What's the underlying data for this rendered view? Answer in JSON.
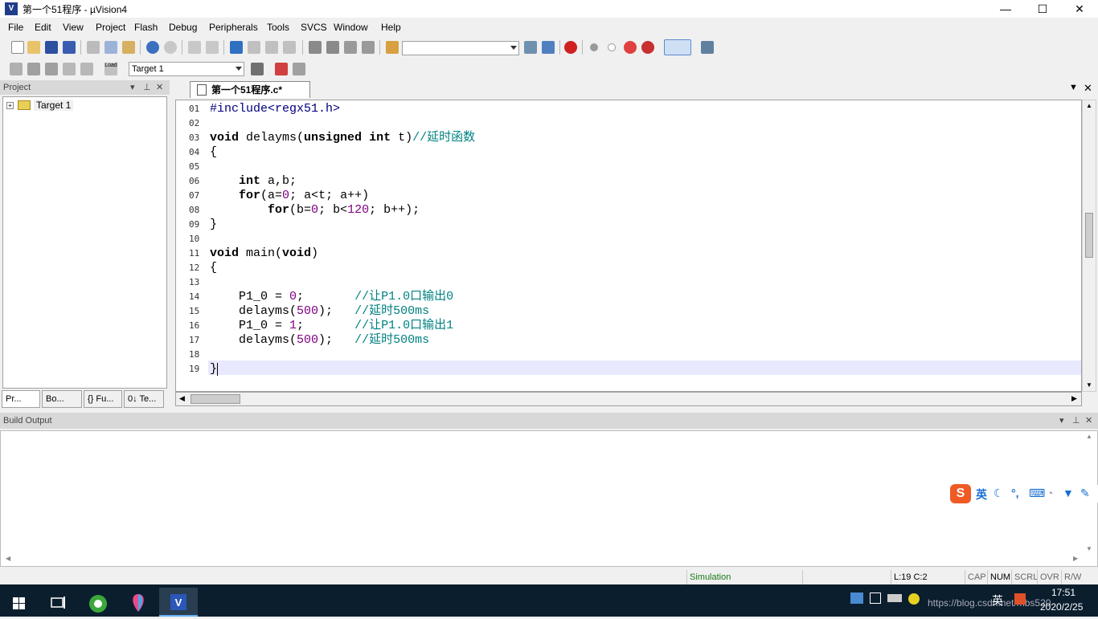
{
  "window": {
    "title": "第一个51程序  - µVision4",
    "minimize": "—",
    "maximize": "☐",
    "close": "✕"
  },
  "menu": [
    "File",
    "Edit",
    "View",
    "Project",
    "Flash",
    "Debug",
    "Peripherals",
    "Tools",
    "SVCS",
    "Window",
    "Help"
  ],
  "toolbar2": {
    "target_combo": "Target 1",
    "load_label": "Load"
  },
  "project_panel": {
    "title": "Project",
    "tree_root": "Target 1",
    "tabs": [
      "Pr...",
      "Bo...",
      "{} Fu...",
      "0↓ Te..."
    ]
  },
  "editor": {
    "tab_label": "第一个51程序.c*",
    "lines": [
      {
        "no": "01",
        "text": "#include<regx51.h>"
      },
      {
        "no": "02",
        "text": ""
      },
      {
        "no": "03",
        "text": "void delayms(unsigned int t)//延时函数"
      },
      {
        "no": "04",
        "text": "{"
      },
      {
        "no": "05",
        "text": ""
      },
      {
        "no": "06",
        "text": "    int a,b;"
      },
      {
        "no": "07",
        "text": "    for(a=0; a<t; a++)"
      },
      {
        "no": "08",
        "text": "        for(b=0; b<120; b++);"
      },
      {
        "no": "09",
        "text": "}"
      },
      {
        "no": "10",
        "text": ""
      },
      {
        "no": "11",
        "text": "void main(void)"
      },
      {
        "no": "12",
        "text": "{"
      },
      {
        "no": "13",
        "text": ""
      },
      {
        "no": "14",
        "text": "    P1_0 = 0;       //让P1.0口输出0"
      },
      {
        "no": "15",
        "text": "    delayms(500);   //延时500ms"
      },
      {
        "no": "16",
        "text": "    P1_0 = 1;       //让P1.0口输出1"
      },
      {
        "no": "17",
        "text": "    delayms(500);   //延时500ms"
      },
      {
        "no": "18",
        "text": ""
      },
      {
        "no": "19",
        "text": "}"
      }
    ]
  },
  "build_output": {
    "title": "Build Output"
  },
  "statusbar": {
    "mode": "Simulation",
    "position": "L:19 C:2",
    "cap": "CAP",
    "num": "NUM",
    "scrl": "SCRL",
    "ovr": "OVR",
    "rw": "R/W"
  },
  "ime_toolbar": {
    "logo": "S",
    "lang": "英"
  },
  "taskbar": {
    "time": "17:51",
    "date": "2020/2/25",
    "ime_lang": "英",
    "watermark": "https://blog.csdn.net/mbs520"
  },
  "colors": {
    "keyword": "#000000",
    "comment": "#008080",
    "number": "#800080",
    "current_line": "#e8e8ff",
    "taskbar": "#0b1e2e"
  }
}
